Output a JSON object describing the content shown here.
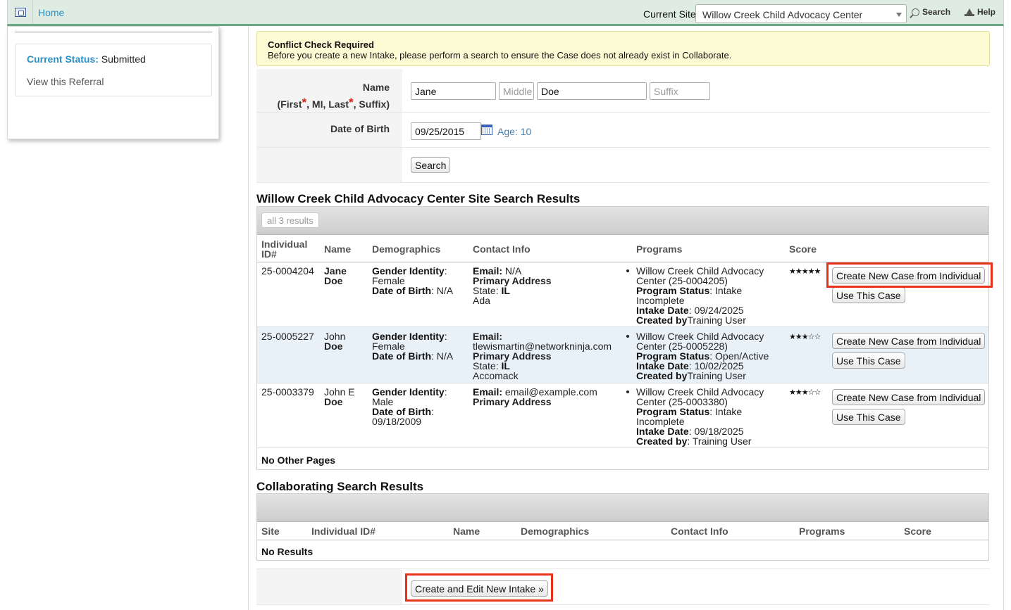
{
  "topbar": {
    "home": "Home",
    "site_label": "Current Site",
    "site_value": "Willow Creek Child Advocacy Center",
    "search": "Search",
    "help": "Help"
  },
  "sidebar": {
    "status_label": "Current Status:",
    "status_value": "Submitted",
    "view_referral": "View this Referral"
  },
  "conflict": {
    "title": "Conflict Check Required",
    "message": "Before you create a new Intake, please perform a search to ensure the Case does not already exist in Collaborate."
  },
  "form": {
    "name_label": "Name",
    "name_sub_first": "(First",
    "name_sub_mid": ", MI, Last",
    "name_sub_end": ", Suffix)",
    "required_mark": "*",
    "first": "Jane",
    "middle_placeholder": "Middle",
    "last": "Doe",
    "suffix_placeholder": "Suffix",
    "dob_label": "Date of Birth",
    "dob": "09/25/2015",
    "age": "Age: 10",
    "search_button": "Search"
  },
  "site_results": {
    "title": "Willow Creek Child Advocacy Center Site Search Results",
    "count_pill": "all 3 results",
    "columns": [
      "Individual ID#",
      "Name",
      "Demographics",
      "Contact Info",
      "Programs",
      "Score"
    ],
    "rows": [
      {
        "id": "25-0004204",
        "first": "Jane",
        "last": "Doe",
        "gender_label": "Gender Identity",
        "gender": "Female",
        "dob_label": "Date of Birth",
        "dob": "N/A",
        "email_label": "Email:",
        "email": "N/A",
        "address_label": "Primary Address",
        "state_label": "State:",
        "state": "IL",
        "county": "Ada",
        "program": "Willow Creek Child Advocacy Center (25-0004205)",
        "status_label": "Program Status",
        "status": "Intake Incomplete",
        "intake_label": "Intake Date",
        "intake": "09/24/2025",
        "created_label": "Created by",
        "created": "Training User",
        "score": "★★★★★"
      },
      {
        "id": "25-0005227",
        "first": "John",
        "last": "Doe",
        "gender_label": "Gender Identity",
        "gender": "Female",
        "dob_label": "Date of Birth",
        "dob": "N/A",
        "email_label": "Email:",
        "email": "tlewismartin@networkninja.com",
        "address_label": "Primary Address",
        "state_label": "State:",
        "state": "IL",
        "county": "Accomack",
        "program": "Willow Creek Child Advocacy Center (25-0005228)",
        "status_label": "Program Status",
        "status": "Open/Active",
        "intake_label": "Intake Date",
        "intake": "10/02/2025",
        "created_label": "Created by",
        "created": "Training User",
        "score": "★★★☆☆"
      },
      {
        "id": "25-0003379",
        "first": "John E",
        "last": "Doe",
        "gender_label": "Gender Identity",
        "gender": "Male",
        "dob_label": "Date of Birth",
        "dob": "09/18/2009",
        "email_label": "Email:",
        "email": "email@example.com",
        "address_label": "Primary Address",
        "program": "Willow Creek Child Advocacy Center (25-0003380)",
        "status_label": "Program Status",
        "status": "Intake Incomplete",
        "intake_label": "Intake Date",
        "intake": "09/18/2025",
        "created_label": "Created by",
        "created": "Training User",
        "score": "★★★☆☆"
      }
    ],
    "create_button": "Create New Case from Individual",
    "use_button": "Use This Case",
    "footer": "No Other Pages"
  },
  "collab_results": {
    "title": "Collaborating Search Results",
    "columns": [
      "Site",
      "Individual ID#",
      "Name",
      "Demographics",
      "Contact Info",
      "Programs",
      "Score"
    ],
    "empty": "No Results"
  },
  "create_intake_button": "Create and Edit New Intake »",
  "colors": {
    "link": "#2a8fc6",
    "highlight": "#e8321e",
    "topbar_bg": "#dfece4",
    "warning_bg": "#fdfbd3"
  }
}
